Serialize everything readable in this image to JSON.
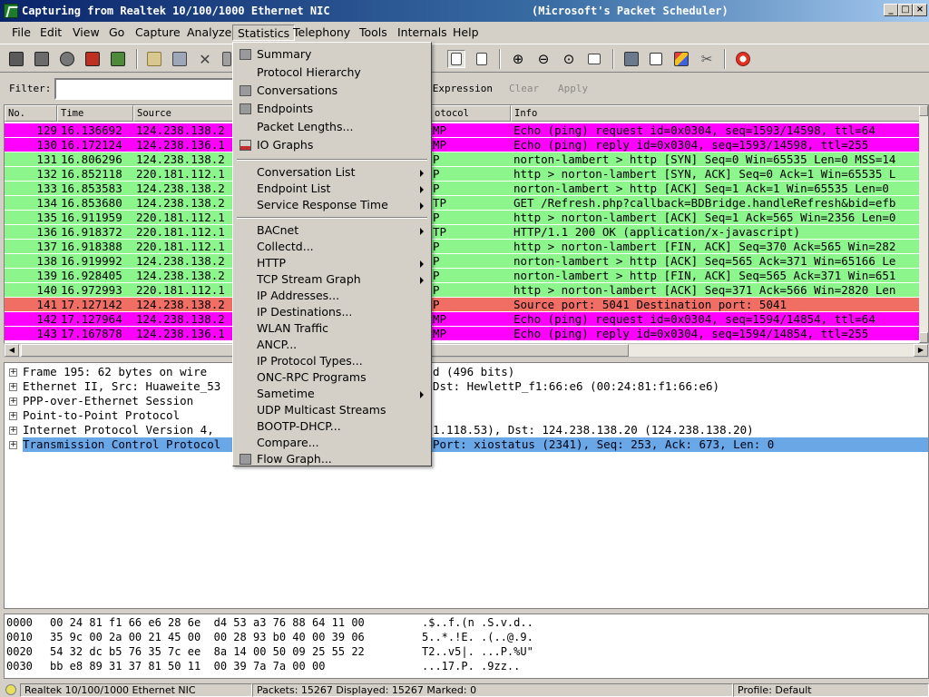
{
  "window": {
    "title": "Capturing from Realtek 10/100/1000 Ethernet NIC",
    "title_suffix": "(Microsoft's Packet Scheduler)"
  },
  "menubar": [
    "File",
    "Edit",
    "View",
    "Go",
    "Capture",
    "Analyze",
    "Statistics",
    "Telephony",
    "Tools",
    "Internals",
    "Help"
  ],
  "filter": {
    "label": "Filter:",
    "value": "",
    "expression_label": "Expression...",
    "clear_label": "Clear",
    "apply_label": "Apply"
  },
  "packet_list": {
    "columns": [
      "No.",
      "Time",
      "Source",
      "Protocol",
      "Info"
    ],
    "column_labels_visible": {
      "no": "No.",
      "time": "Time",
      "source": "Source",
      "protocol": "otocol",
      "info": "Info"
    },
    "rows": [
      {
        "no": "129",
        "time": "16.136692",
        "source": "124.238.138.2",
        "protocol": "MP",
        "info": "Echo (ping) request  id=0x0304, seq=1593/14598, ttl=64",
        "bg": "#ff00ff",
        "fg": "#000000"
      },
      {
        "no": "130",
        "time": "16.172124",
        "source": "124.238.136.1",
        "protocol": "MP",
        "info": "Echo (ping) reply    id=0x0304, seq=1593/14598, ttl=255",
        "bg": "#ff00ff",
        "fg": "#000000"
      },
      {
        "no": "131",
        "time": "16.806296",
        "source": "124.238.138.2",
        "protocol": "P",
        "info": "norton-lambert > http [SYN] Seq=0 Win=65535 Len=0 MSS=14",
        "bg": "#8cf58c",
        "fg": "#000000"
      },
      {
        "no": "132",
        "time": "16.852118",
        "source": "220.181.112.1",
        "protocol": "P",
        "info": "http > norton-lambert [SYN, ACK] Seq=0 Ack=1 Win=65535 L",
        "bg": "#8cf58c",
        "fg": "#000000"
      },
      {
        "no": "133",
        "time": "16.853583",
        "source": "124.238.138.2",
        "protocol": "P",
        "info": "norton-lambert > http [ACK] Seq=1 Ack=1 Win=65535 Len=0",
        "bg": "#8cf58c",
        "fg": "#000000"
      },
      {
        "no": "134",
        "time": "16.853680",
        "source": "124.238.138.2",
        "protocol": "TP",
        "info": "GET /Refresh.php?callback=BDBridge.handleRefresh&bid=efb",
        "bg": "#8cf58c",
        "fg": "#000000"
      },
      {
        "no": "135",
        "time": "16.911959",
        "source": "220.181.112.1",
        "protocol": "P",
        "info": "http > norton-lambert [ACK] Seq=1 Ack=565 Win=2356 Len=0",
        "bg": "#8cf58c",
        "fg": "#000000"
      },
      {
        "no": "136",
        "time": "16.918372",
        "source": "220.181.112.1",
        "protocol": "TP",
        "info": "HTTP/1.1 200 OK  (application/x-javascript)",
        "bg": "#8cf58c",
        "fg": "#000000"
      },
      {
        "no": "137",
        "time": "16.918388",
        "source": "220.181.112.1",
        "protocol": "P",
        "info": "http > norton-lambert [FIN, ACK] Seq=370 Ack=565 Win=282",
        "bg": "#8cf58c",
        "fg": "#000000"
      },
      {
        "no": "138",
        "time": "16.919992",
        "source": "124.238.138.2",
        "protocol": "P",
        "info": "norton-lambert > http [ACK] Seq=565 Ack=371 Win=65166 Le",
        "bg": "#8cf58c",
        "fg": "#000000"
      },
      {
        "no": "139",
        "time": "16.928405",
        "source": "124.238.138.2",
        "protocol": "P",
        "info": "norton-lambert > http [FIN, ACK] Seq=565 Ack=371 Win=651",
        "bg": "#8cf58c",
        "fg": "#000000"
      },
      {
        "no": "140",
        "time": "16.972993",
        "source": "220.181.112.1",
        "protocol": "P",
        "info": "http > norton-lambert [ACK] Seq=371 Ack=566 Win=2820 Len",
        "bg": "#8cf58c",
        "fg": "#000000"
      },
      {
        "no": "141",
        "time": "17.127142",
        "source": "124.238.138.2",
        "protocol": "P",
        "info": "Source port: 5041  Destination port: 5041",
        "bg": "#f06e64",
        "fg": "#000000"
      },
      {
        "no": "142",
        "time": "17.127964",
        "source": "124.238.138.2",
        "protocol": "MP",
        "info": "Echo (ping) request  id=0x0304, seq=1594/14854, ttl=64",
        "bg": "#ff00ff",
        "fg": "#000000"
      },
      {
        "no": "143",
        "time": "17.167878",
        "source": "124.238.136.1",
        "protocol": "MP",
        "info": "Echo (ping) reply    id=0x0304, seq=1594/14854, ttl=255",
        "bg": "#ff00ff",
        "fg": "#000000"
      }
    ]
  },
  "details": [
    {
      "text": "Frame 195: 62 bytes on wire (496 bits)                 d (496 bits)",
      "left": "Frame 195: 62 bytes on wire ",
      "right": "d (496 bits)"
    },
    {
      "left": "Ethernet II, Src: Huaweite_53",
      "right": "Dst: HewlettP_f1:66:e6 (00:24:81:f1:66:e6)"
    },
    {
      "left": "PPP-over-Ethernet Session",
      "right": ""
    },
    {
      "left": "Point-to-Point Protocol",
      "right": ""
    },
    {
      "left": "Internet Protocol Version 4, ",
      "right": "1.118.53), Dst: 124.238.138.20 (124.238.138.20)"
    },
    {
      "left": "Transmission Control Protocol",
      "right": "Port: xiostatus (2341), Seq: 253, Ack: 673, Len: 0"
    }
  ],
  "hex": [
    {
      "offset": "0000",
      "bytes": "00 24 81 f1 66 e6 28 6e  d4 53 a3 76 88 64 11 00",
      "ascii": ".$..f.(n .S.v.d.."
    },
    {
      "offset": "0010",
      "bytes": "35 9c 00 2a 00 21 45 00  00 28 93 b0 40 00 39 06",
      "ascii": "5..*.!E. .(..@.9."
    },
    {
      "offset": "0020",
      "bytes": "54 32 dc b5 76 35 7c ee  8a 14 00 50 09 25 55 22",
      "ascii": "T2..v5|. ...P.%U\""
    },
    {
      "offset": "0030",
      "bytes": "bb e8 89 31 37 81 50 11  00 39 7a 7a 00 00",
      "ascii": "...17.P. .9zz.."
    }
  ],
  "status": {
    "interface": "Realtek 10/100/1000 Ethernet NIC",
    "packets": "Packets: 15267 Displayed: 15267 Marked: 0",
    "profile": "Profile: Default"
  },
  "statistics_menu": {
    "group1": [
      "Summary",
      "Protocol Hierarchy",
      "Conversations",
      "Endpoints",
      "Packet Lengths...",
      "IO Graphs"
    ],
    "group2": [
      "Conversation List",
      "Endpoint List",
      "Service Response Time"
    ],
    "group3": [
      "BACnet",
      "Collectd...",
      "HTTP",
      "TCP Stream Graph",
      "IP Addresses...",
      "IP Destinations...",
      "WLAN Traffic",
      "ANCP...",
      "IP Protocol Types...",
      "ONC-RPC Programs",
      "Sametime",
      "UDP Multicast Streams",
      "BOOTP-DHCP...",
      "Compare...",
      "Flow Graph..."
    ]
  },
  "colors": {
    "icmp_bg": "#ff00ff",
    "tcp_bg": "#8cf58c",
    "udp_bg": "#f06e64",
    "selection_bg": "#6aa7e6"
  }
}
